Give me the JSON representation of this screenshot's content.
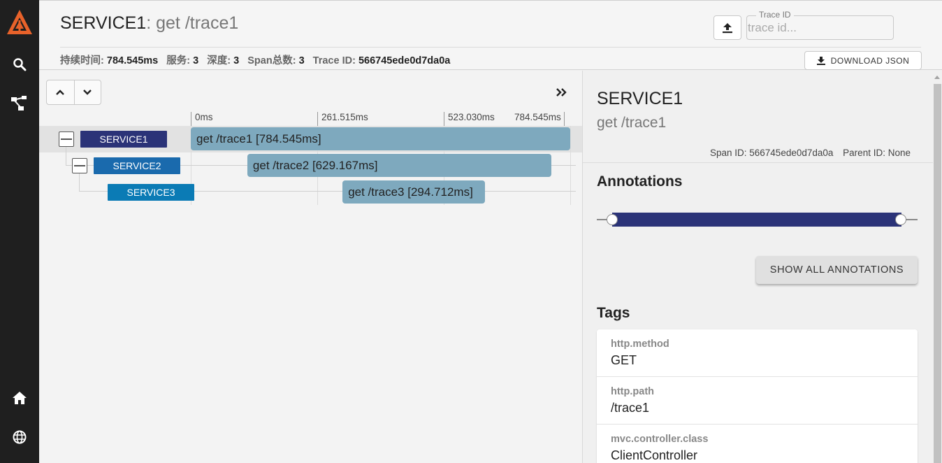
{
  "sidebar": {
    "logo": "zipkin-logo-icon",
    "items": [
      {
        "icon": "search-icon"
      },
      {
        "icon": "dependencies-icon"
      },
      {
        "icon": "home-icon"
      },
      {
        "icon": "globe-icon"
      }
    ]
  },
  "header": {
    "service_name": "SERVICE1",
    "separator": ":",
    "span_name": " get /trace1",
    "stats": [
      {
        "label": "持续时间:",
        "value": "784.545ms"
      },
      {
        "label": "服务:",
        "value": "3"
      },
      {
        "label": "深度:",
        "value": "3"
      },
      {
        "label": "Span总数:",
        "value": "3"
      },
      {
        "label": "Trace ID:",
        "value": "566745ede0d7da0a"
      }
    ],
    "trace_id_label": "Trace ID",
    "trace_id_placeholder": "trace id...",
    "download_label": "DOWNLOAD JSON"
  },
  "timeline": {
    "ticks": [
      "0ms",
      "261.515ms",
      "523.030ms",
      "784.545ms"
    ],
    "total_duration_ms": 784.545,
    "spans": [
      {
        "service": "SERVICE1",
        "label": "get /trace1 [784.545ms]",
        "start_ms": 0,
        "duration_ms": 784.545,
        "depth": 0,
        "color": "#2b3378",
        "collapsible": true
      },
      {
        "service": "SERVICE2",
        "label": "get /trace2 [629.167ms]",
        "start_ms": 116.9,
        "duration_ms": 629.167,
        "depth": 1,
        "color": "#1a6aad",
        "collapsible": true
      },
      {
        "service": "SERVICE3",
        "label": "get /trace3 [294.712ms]",
        "start_ms": 313.8,
        "duration_ms": 294.712,
        "depth": 2,
        "color": "#0b7bb5",
        "collapsible": false
      }
    ]
  },
  "detail": {
    "service": "SERVICE1",
    "span_name": "get /trace1",
    "span_id_label": "Span ID:",
    "span_id": "566745ede0d7da0a",
    "parent_id_label": "Parent ID:",
    "parent_id": "None",
    "annotations_heading": "Annotations",
    "show_all_label": "SHOW ALL ANNOTATIONS",
    "tags_heading": "Tags",
    "tags": [
      {
        "key": "http.method",
        "value": "GET"
      },
      {
        "key": "http.path",
        "value": "/trace1"
      },
      {
        "key": "mvc.controller.class",
        "value": "ClientController"
      }
    ]
  },
  "colors": {
    "sidebar_bg": "#1f1f1f",
    "logo_orange": "#e8622a",
    "span_bar": "#7ea9be",
    "annotation_bar": "#2b3378"
  }
}
